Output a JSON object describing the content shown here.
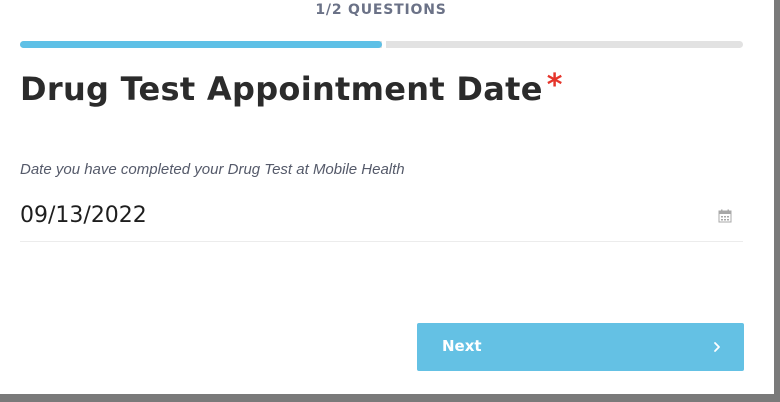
{
  "progress": {
    "label": "1/2 QUESTIONS",
    "fraction": 0.5,
    "fill_color": "#5ec0e6",
    "track_color": "#e2e2e2"
  },
  "question": {
    "title": "Drug Test Appointment Date",
    "required_marker": "*",
    "description": "Date you have completed your Drug Test at Mobile Health"
  },
  "date_field": {
    "value": "09/13/2022",
    "icon": "calendar-icon"
  },
  "next_button": {
    "label": "Next",
    "icon": "chevron-right-icon",
    "color": "#64c1e4"
  }
}
